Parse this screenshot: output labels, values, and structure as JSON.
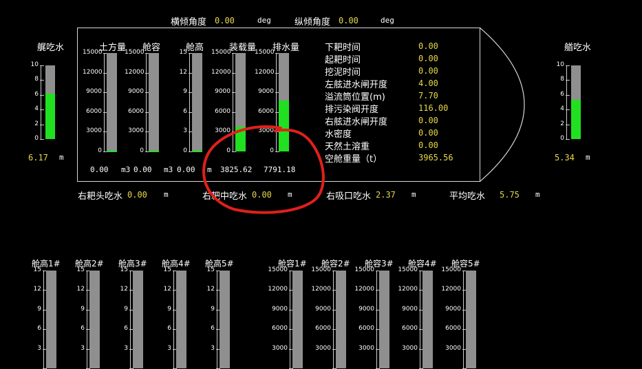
{
  "top": {
    "heel_label": "横倾角度",
    "heel_value": "0.00",
    "heel_unit": "deg",
    "trim_label": "纵倾角度",
    "trim_value": "0.00",
    "trim_unit": "deg"
  },
  "stern_draft": {
    "label": "艉吃水",
    "value": "6.17",
    "unit": "m",
    "fill_fraction": 0.617,
    "ticks": [
      "10",
      "8",
      "6",
      "4",
      "2",
      "0"
    ]
  },
  "bow_draft": {
    "label": "艏吃水",
    "value": "5.34",
    "unit": "m",
    "fill_fraction": 0.534,
    "ticks": [
      "10",
      "8",
      "6",
      "4",
      "2",
      "0"
    ]
  },
  "hull_gauges": [
    {
      "label": "土方量",
      "ticks": [
        "15000",
        "12000",
        "9000",
        "6000",
        "3000",
        "0"
      ],
      "fill_fraction": 0.0,
      "value": "0.00",
      "unit": "m3"
    },
    {
      "label": "舱容",
      "ticks": [
        "15000",
        "12000",
        "9000",
        "6000",
        "3000",
        "0"
      ],
      "fill_fraction": 0.0,
      "value": "0.00",
      "unit": "m3"
    },
    {
      "label": "舱高",
      "ticks": [
        "15",
        "12",
        "9",
        "6",
        "3",
        "0"
      ],
      "fill_fraction": 0.0,
      "value": "0.00",
      "unit": "m"
    },
    {
      "label": "装载量",
      "ticks": [
        "15000",
        "12000",
        "9000",
        "6000",
        "3000",
        "0"
      ],
      "fill_fraction": 0.255,
      "value": "3825.62",
      "unit": ""
    },
    {
      "label": "排水量",
      "ticks": [
        "15000",
        "12000",
        "9000",
        "6000",
        "3000",
        "0"
      ],
      "fill_fraction": 0.519,
      "value": "7791.18",
      "unit": ""
    }
  ],
  "info": [
    {
      "key": "下耙时间",
      "value": "0.00"
    },
    {
      "key": "起耙时间",
      "value": "0.00"
    },
    {
      "key": "挖泥时间",
      "value": "0.00"
    },
    {
      "key": "左舷进水闸开度",
      "value": "4.00"
    },
    {
      "key": "溢流筒位置(m)",
      "value": "7.70"
    },
    {
      "key": "排污染阀开度",
      "value": "116.00"
    },
    {
      "key": "右舷进水闸开度",
      "value": "0.00"
    },
    {
      "key": "水密度",
      "value": "0.00"
    },
    {
      "key": "天然土溶重",
      "value": "0.00"
    },
    {
      "key": "空舱重量（t）",
      "value": "3965.56"
    }
  ],
  "drafts_row": {
    "right_head": {
      "label": "右耙头吃水",
      "value": "0.00",
      "unit": "m"
    },
    "right_mid": {
      "label": "右耙中吃水",
      "value": "0.00",
      "unit": "m"
    },
    "right_suction": {
      "label": "右吸口吃水",
      "value": "2.37",
      "unit": "m"
    },
    "average": {
      "label": "平均吃水",
      "value": "5.75",
      "unit": "m"
    }
  },
  "hold_heights": [
    {
      "label": "舱高1#",
      "ticks": [
        "15",
        "12",
        "9",
        "6",
        "3"
      ]
    },
    {
      "label": "舱高2#",
      "ticks": [
        "15",
        "12",
        "9",
        "6",
        "3"
      ]
    },
    {
      "label": "舱高3#",
      "ticks": [
        "15",
        "12",
        "9",
        "6",
        "3"
      ]
    },
    {
      "label": "舱高4#",
      "ticks": [
        "15",
        "12",
        "9",
        "6",
        "3"
      ]
    },
    {
      "label": "舱高5#",
      "ticks": [
        "15",
        "12",
        "9",
        "6",
        "3"
      ]
    }
  ],
  "hold_volumes": [
    {
      "label": "舱容1#",
      "ticks": [
        "15000",
        "12000",
        "9000",
        "6000",
        "3000"
      ]
    },
    {
      "label": "舱容2#",
      "ticks": [
        "15000",
        "12000",
        "9000",
        "6000",
        "3000"
      ]
    },
    {
      "label": "舱容3#",
      "ticks": [
        "15000",
        "12000",
        "9000",
        "6000",
        "3000"
      ]
    },
    {
      "label": "舱容4#",
      "ticks": [
        "15000",
        "12000",
        "9000",
        "6000",
        "3000"
      ]
    },
    {
      "label": "舱容5#",
      "ticks": [
        "15000",
        "12000",
        "9000",
        "6000",
        "3000"
      ]
    }
  ],
  "colors": {
    "fill": "#21e021",
    "track": "#8f8f8f",
    "value": "#e8d84a",
    "annotation": "#e0201b"
  }
}
